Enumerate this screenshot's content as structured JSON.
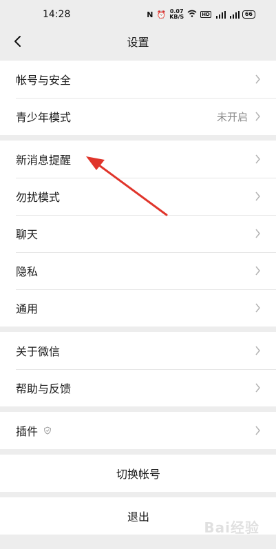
{
  "status": {
    "time": "14:28",
    "speed_value": "0.07",
    "speed_unit": "KB/S",
    "battery": "66"
  },
  "nav": {
    "title": "设置"
  },
  "groups": [
    {
      "items": [
        {
          "label": "帐号与安全",
          "value": ""
        },
        {
          "label": "青少年模式",
          "value": "未开启"
        }
      ]
    },
    {
      "items": [
        {
          "label": "新消息提醒",
          "value": ""
        },
        {
          "label": "勿扰模式",
          "value": ""
        },
        {
          "label": "聊天",
          "value": ""
        },
        {
          "label": "隐私",
          "value": ""
        },
        {
          "label": "通用",
          "value": ""
        }
      ]
    },
    {
      "items": [
        {
          "label": "关于微信",
          "value": ""
        },
        {
          "label": "帮助与反馈",
          "value": ""
        }
      ]
    },
    {
      "items": [
        {
          "label": "插件",
          "value": ""
        }
      ]
    }
  ],
  "actions": {
    "switch_account": "切换帐号",
    "logout": "退出"
  },
  "watermark": "Bai经验",
  "colors": {
    "annotation_arrow": "#e0352b",
    "background": "#ededed"
  }
}
